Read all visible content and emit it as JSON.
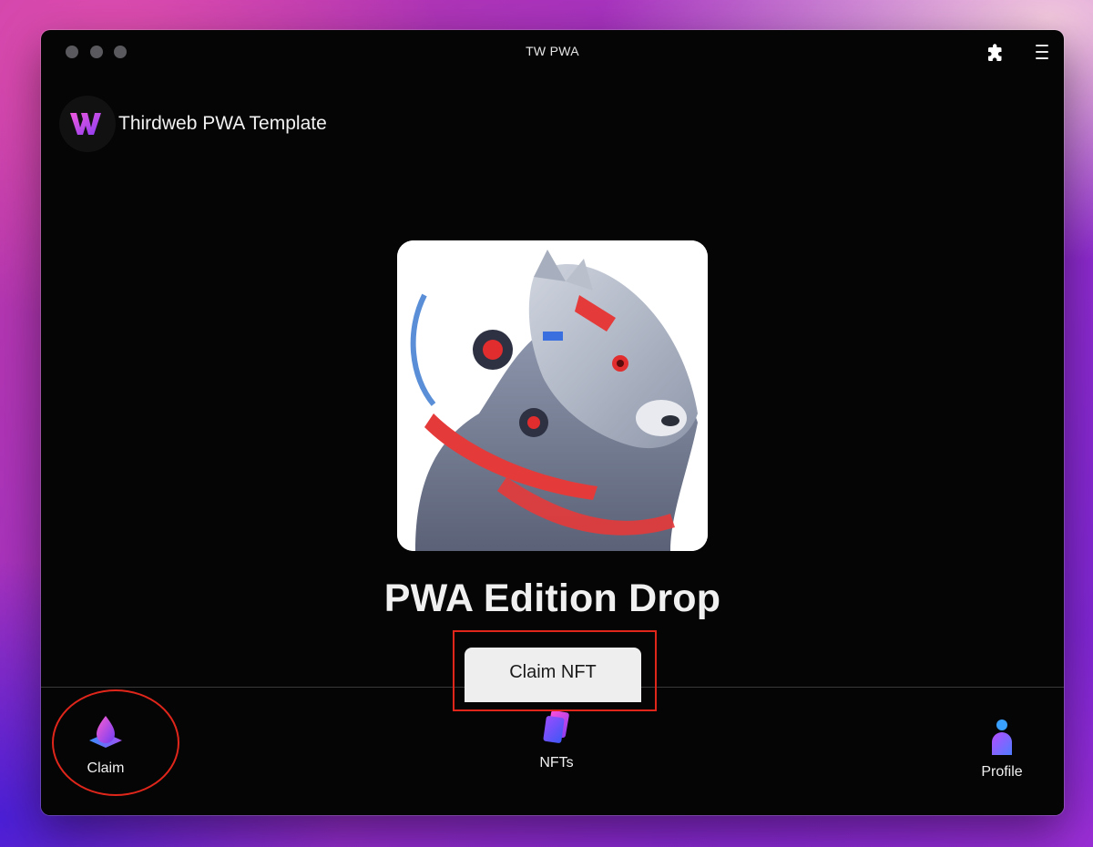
{
  "window": {
    "title": "TW PWA"
  },
  "header": {
    "brand_name": "Thirdweb PWA Template",
    "logo_icon": "thirdweb-w-logo-icon",
    "extensions_icon": "puzzle-icon",
    "menu_icon": "menu-icon"
  },
  "main": {
    "nft_image_alt": "panther-robot-artwork",
    "nft_title": "PWA Edition Drop",
    "claim_label": "Claim NFT"
  },
  "bottom_nav": {
    "items": [
      {
        "label": "Claim",
        "icon": "claim-drop-icon"
      },
      {
        "label": "NFTs",
        "icon": "nft-cards-icon"
      },
      {
        "label": "Profile",
        "icon": "profile-person-icon"
      }
    ]
  },
  "colors": {
    "window_bg": "#050505",
    "text": "#f0f0f0",
    "button_bg": "#eeeeee",
    "annotation": "#e0261b",
    "accent_purple": "#9b3cf0",
    "accent_pink": "#e040c0",
    "accent_blue": "#3a8dff"
  }
}
